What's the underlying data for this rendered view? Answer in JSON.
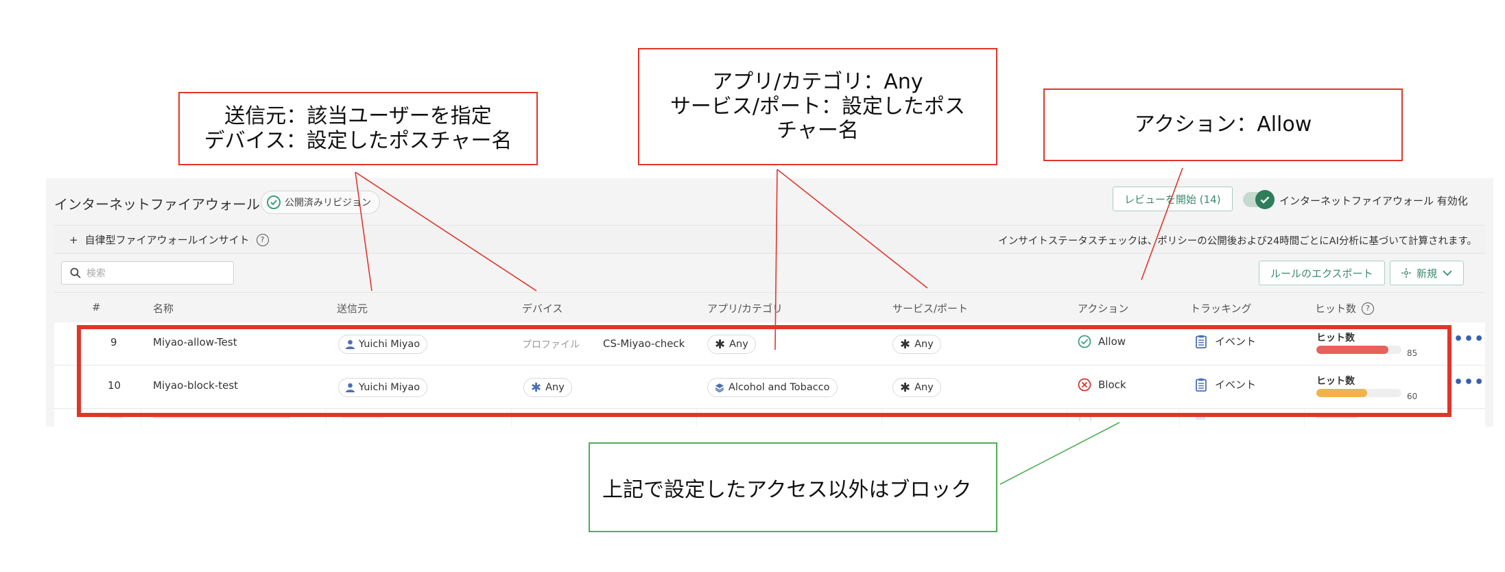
{
  "app": {
    "title": "インターネットファイアウォール",
    "published_badge": "公開済みリビジョン",
    "review_button": "レビューを開始 (14)",
    "enable_label": "インターネットファイアウォール 有効化",
    "enabled": true
  },
  "insight": {
    "toggle_icon": "+",
    "label": "自律型ファイアウォールインサイト",
    "notice": "インサイトステータスチェックは、ポリシーの公開後および24時間ごとにAI分析に基づいて計算されます。"
  },
  "toolbar": {
    "search_placeholder": "検索",
    "export_label": "ルールのエクスポート",
    "new_label": "新規"
  },
  "table": {
    "columns": [
      "#",
      "名称",
      "送信元",
      "デバイス",
      "アプリ/カテゴリ",
      "サービス/ポート",
      "アクション",
      "トラッキング",
      "ヒット数"
    ],
    "rows": [
      {
        "num": "9",
        "name": "Miyao-allow-Test",
        "source": "Yuichi Miyao",
        "device_label": "プロファイル",
        "device": "CS-Miyao-check",
        "app": "Any",
        "service": "Any",
        "action": "Allow",
        "tracking": "イベント",
        "hit_label": "ヒット数",
        "hits": 85,
        "hit_color": "#e8625c"
      },
      {
        "num": "10",
        "name": "Miyao-block-test",
        "source": "Yuichi Miyao",
        "device": "Any",
        "app": "Alcohol and Tobacco",
        "service": "Any",
        "action": "Block",
        "tracking": "イベント",
        "hit_label": "ヒット数",
        "hits": 60,
        "hit_color": "#f2b24a"
      }
    ]
  },
  "annotations": {
    "source_device": "送信元：該当ユーザーを指定\nデバイス：設定したポスチャー名",
    "app_service": "アプリ/カテゴリ：Any\nサービス/ポート：設定したポス\nチャー名",
    "action": "アクション：Allow",
    "block_note": "上記で設定したアクセス以外はブロック"
  },
  "colors": {
    "annotation_red": "#e0352b",
    "annotation_green": "#4caf50",
    "accent_green": "#2e7d5b",
    "allow_green": "#3aa17e",
    "block_red": "#d9342b",
    "more_blue": "#3a5fb0"
  }
}
